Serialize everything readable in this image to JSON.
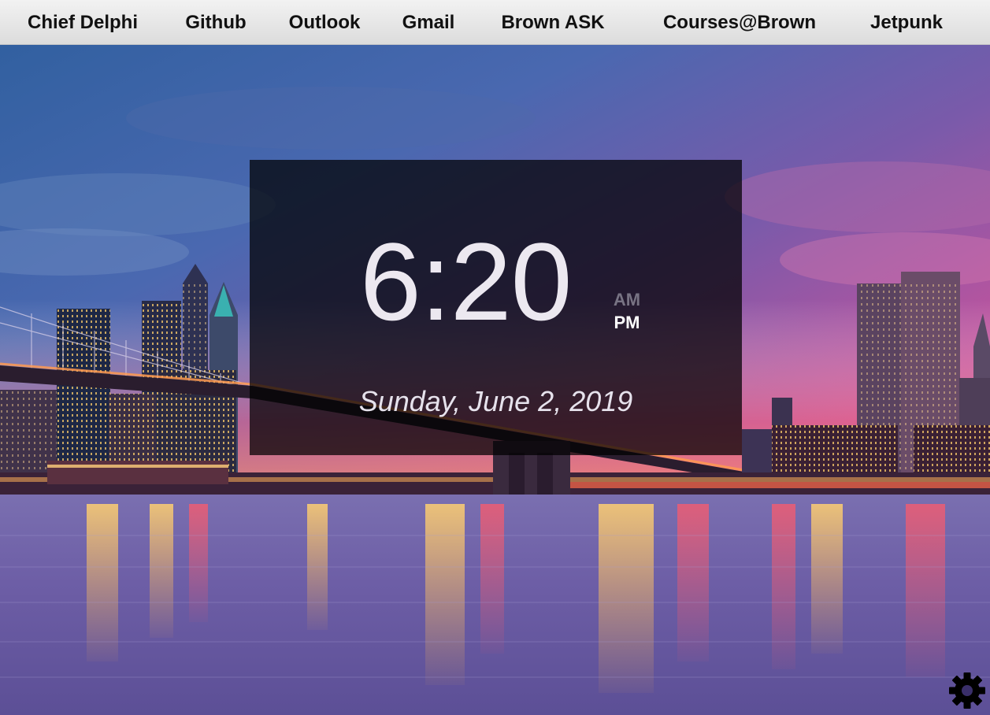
{
  "nav": {
    "links": [
      {
        "label": "Chief Delphi"
      },
      {
        "label": "Github"
      },
      {
        "label": "Outlook"
      },
      {
        "label": "Gmail"
      },
      {
        "label": "Brown ASK"
      },
      {
        "label": "Courses@Brown"
      },
      {
        "label": "Jetpunk"
      }
    ]
  },
  "clock": {
    "time": "6:20",
    "am_label": "AM",
    "pm_label": "PM",
    "active_period": "PM",
    "date": "Sunday, June 2, 2019"
  },
  "background": {
    "description_icon": "city-skyline-photo",
    "colors": {
      "sky_top": "#3b6aa8",
      "sky_mid": "#6a58a8",
      "sky_sunset": "#d8589c",
      "horizon_glow": "#f07a6a",
      "water": "#6a5a9a"
    }
  },
  "settings": {
    "icon": "gear-icon",
    "color": "#000000"
  },
  "colors": {
    "nav_bg": "#e8e8e8",
    "nav_text": "#111111",
    "panel_bg": "rgba(0,0,0,0.72)",
    "clock_text": "#ece8f0"
  }
}
